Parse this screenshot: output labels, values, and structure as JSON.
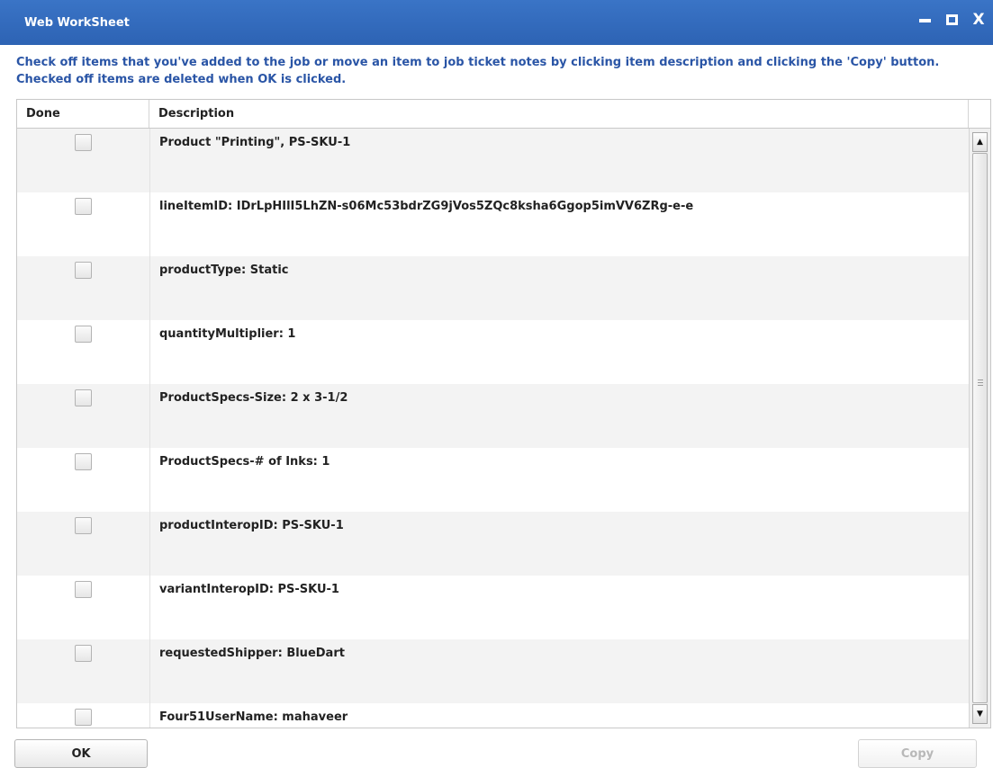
{
  "window": {
    "title": "Web WorkSheet",
    "minimize_icon": "minimize-icon",
    "maximize_icon": "maximize-icon",
    "close_icon": "close-icon",
    "close_glyph": "X"
  },
  "instructions": "Check off items that you've added to the job or move an item to job ticket notes by clicking item description and clicking the 'Copy' button. Checked off items are deleted when OK is clicked.",
  "table": {
    "columns": {
      "done": "Done",
      "description": "Description"
    },
    "rows": [
      {
        "description": "Product \"Printing\", PS-SKU-1",
        "checked": false
      },
      {
        "description": "lineItemID: IDrLpHIlI5LhZN-s06Mc53bdrZG9jVos5ZQc8ksha6Ggop5imVV6ZRg-e-e",
        "checked": false
      },
      {
        "description": "productType: Static",
        "checked": false
      },
      {
        "description": "quantityMultiplier: 1",
        "checked": false
      },
      {
        "description": "ProductSpecs-Size: 2 x 3-1/2",
        "checked": false
      },
      {
        "description": "ProductSpecs-# of Inks: 1",
        "checked": false
      },
      {
        "description": "productInteropID: PS-SKU-1",
        "checked": false
      },
      {
        "description": "variantInteropID: PS-SKU-1",
        "checked": false
      },
      {
        "description": "requestedShipper: BlueDart",
        "checked": false
      },
      {
        "description": "Four51UserName: mahaveer",
        "checked": false
      }
    ]
  },
  "scrollbar": {
    "up_glyph": "▲",
    "down_glyph": "▼",
    "position_fraction": 0.0
  },
  "buttons": {
    "ok": "OK",
    "copy": "Copy"
  },
  "colors": {
    "titlebar": "#2d63b4",
    "instruction_text": "#2a55a6",
    "row_alt": "#f3f3f3"
  }
}
